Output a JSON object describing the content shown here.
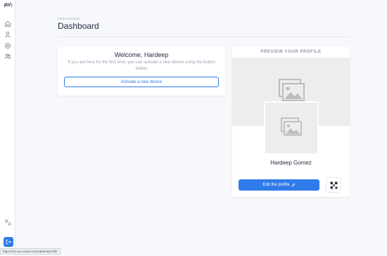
{
  "sidebar": {
    "logo_text": "AV",
    "items": [
      {
        "icon": "home-icon"
      },
      {
        "icon": "user-icon"
      },
      {
        "icon": "device-icon"
      },
      {
        "icon": "users-icon"
      }
    ],
    "language_icon": "translate-icon",
    "logout_icon": "logout-icon"
  },
  "header": {
    "subtitle": "PREVIEWING",
    "title": "Dashboard"
  },
  "welcome": {
    "title": "Welcome, Hardeep",
    "description": "If you are here for the first time, you can activate a new device using the button below",
    "activate_label": "Activate a new device"
  },
  "profile": {
    "header": "PREVIEW YOUR PROFILE",
    "name": "Hardeep Gomez",
    "edit_label": "Edit the profile",
    "qr_icon": "qr-code-icon"
  },
  "status_bar": {
    "url": "https://me.av-ecard.com/cabinet/profile"
  },
  "colors": {
    "accent": "#2f7bea",
    "background": "#f7f8fb",
    "placeholder": "#ededed"
  }
}
